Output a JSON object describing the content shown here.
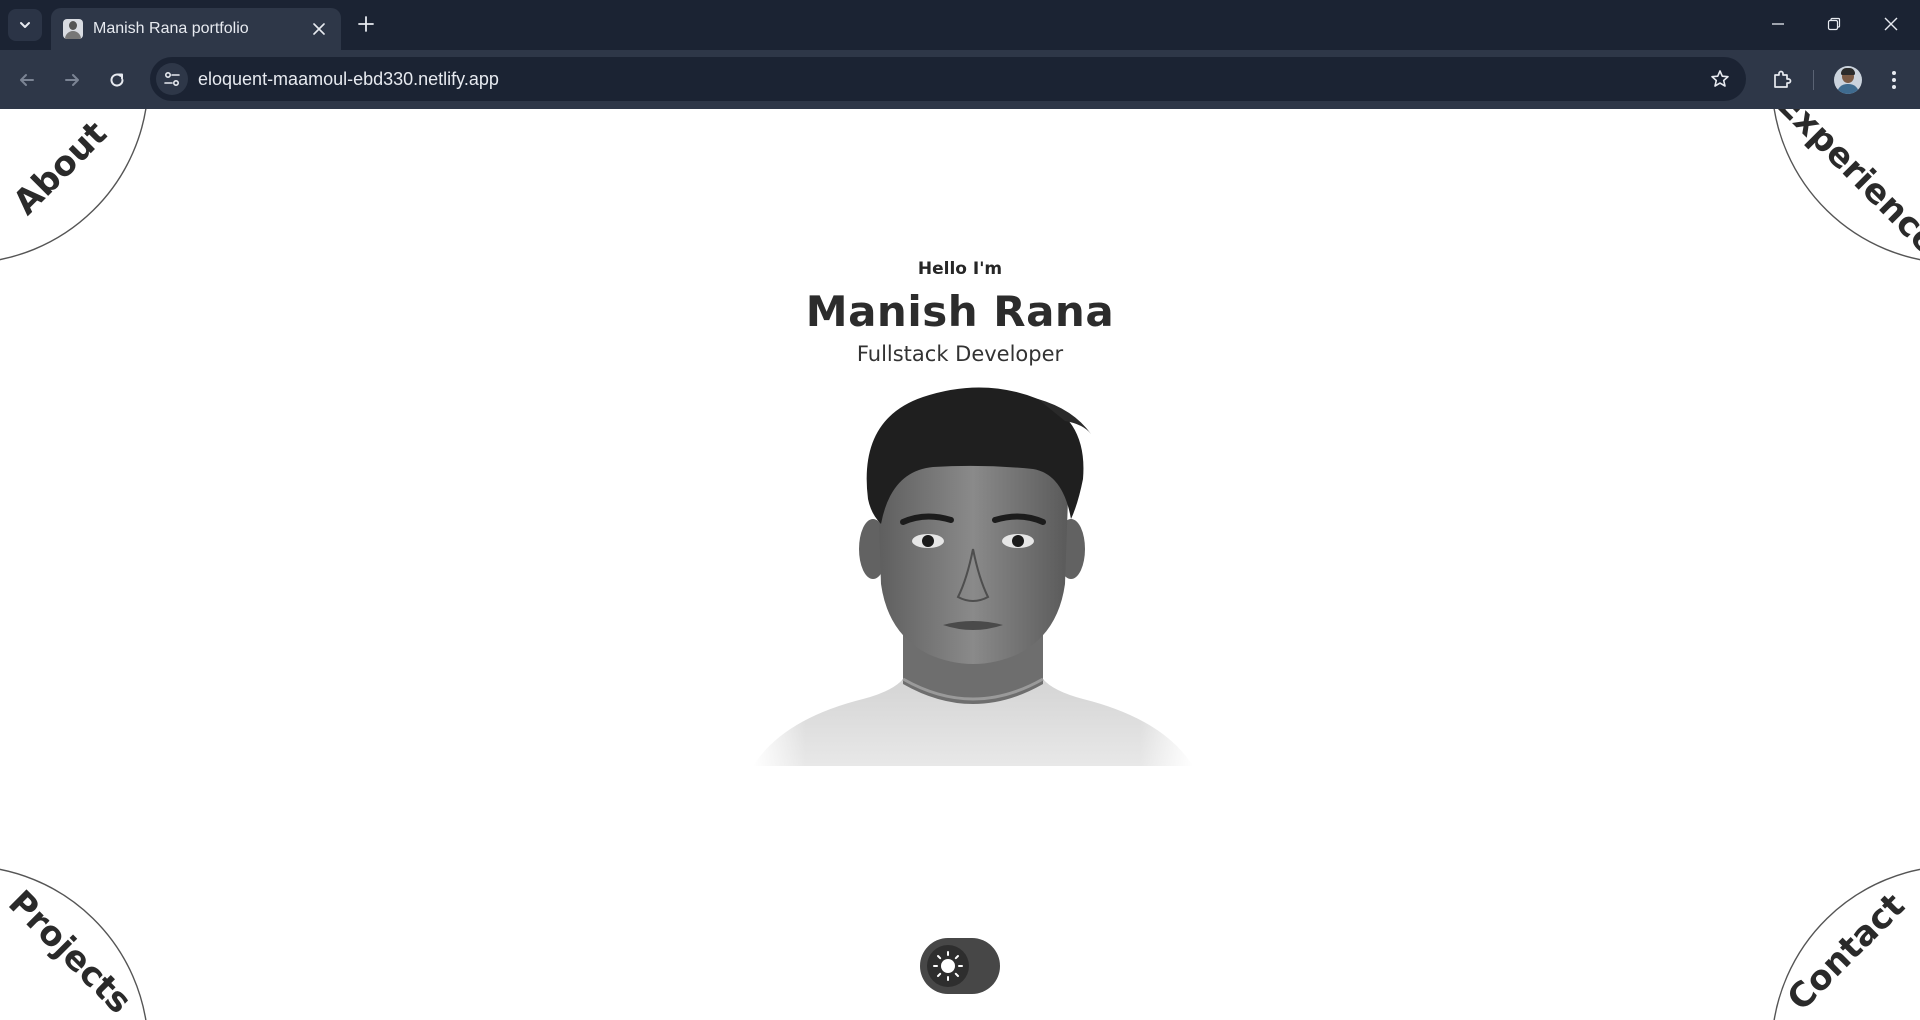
{
  "browser": {
    "tab": {
      "title": "Manish Rana portfolio",
      "favicon": "portrait-favicon-icon"
    },
    "address_bar": {
      "url": "eloquent-maamoul-ebd330.netlify.app"
    },
    "icons": {
      "tab_search": "chevron-down-icon",
      "close_tab": "close-icon",
      "new_tab": "plus-icon",
      "back": "arrow-left-icon",
      "forward": "arrow-right-icon",
      "reload": "reload-icon",
      "site_info": "tune-icon",
      "bookmark": "star-icon",
      "extensions": "puzzle-icon",
      "profile": "avatar",
      "menu": "kebab-menu-icon",
      "minimize": "minimize-icon",
      "restore": "restore-icon",
      "close_window": "close-icon"
    },
    "colors": {
      "tabbar": "#1b2333",
      "toolbar": "#2e3748",
      "text": "#e7eaf0"
    }
  },
  "page": {
    "nav": {
      "about": "About",
      "experience": "Experience",
      "projects": "Projects",
      "contact": "Contact"
    },
    "hero": {
      "greeting": "Hello I'm",
      "name": "Manish Rana",
      "role": "Fullstack Developer"
    },
    "theme_toggle": {
      "icon": "sun-icon",
      "mode": "light"
    },
    "colors": {
      "background": "#ffffff",
      "text": "#2c2c2c",
      "toggle": "#474747"
    }
  }
}
